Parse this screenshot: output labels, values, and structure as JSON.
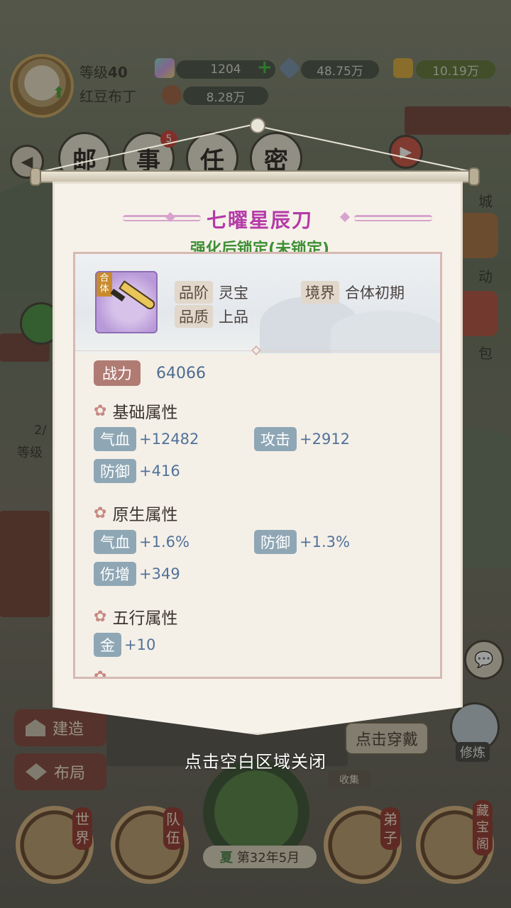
{
  "player": {
    "level_label": "等级",
    "level": "40",
    "name": "红豆布丁"
  },
  "resources": {
    "gems": "1204",
    "crystals": "48.75万",
    "gold": "10.19万",
    "material": "8.28万"
  },
  "top_nav": {
    "mail": "邮",
    "events": "事",
    "events_badge": "5",
    "tasks": "任",
    "secrets": "密"
  },
  "side_labels": {
    "shop": "城",
    "activity": "动",
    "bag": "包",
    "level_partial": "等级",
    "progress_partial": "2/"
  },
  "left_buttons": {
    "build": "建造",
    "layout": "布局"
  },
  "bottom_nav": {
    "world": "世界",
    "team": "队伍",
    "disciples": "弟子",
    "treasury": "藏宝阁",
    "collect": "收集",
    "season": "夏",
    "date": "第32年5月",
    "wear_button": "点击穿戴",
    "cultivate": "修炼"
  },
  "item": {
    "name": "七曜星辰刀",
    "lock_status": "强化后锁定(未锁定)",
    "icon_tag": "合体",
    "grade_label": "品阶",
    "grade": "灵宝",
    "realm_label": "境界",
    "realm": "合体初期",
    "quality_label": "品质",
    "quality": "上品",
    "power_label": "战力",
    "power": "64066",
    "sections": {
      "base": {
        "title": "基础属性",
        "attrs": [
          {
            "name": "气血",
            "value": "+12482"
          },
          {
            "name": "攻击",
            "value": "+2912"
          },
          {
            "name": "防御",
            "value": "+416"
          }
        ]
      },
      "native": {
        "title": "原生属性",
        "attrs": [
          {
            "name": "气血",
            "value": "+1.6%"
          },
          {
            "name": "防御",
            "value": "+1.3%"
          },
          {
            "name": "伤增",
            "value": "+349"
          }
        ]
      },
      "elements": {
        "title": "五行属性",
        "attrs": [
          {
            "name": "金",
            "value": "+10"
          }
        ]
      }
    }
  },
  "close_hint": "点击空白区域关闭",
  "colors": {
    "title": "#b43aa7",
    "lock_status": "#3e8f35",
    "attr_value": "#52719a",
    "power_tag": "#b07b73"
  }
}
